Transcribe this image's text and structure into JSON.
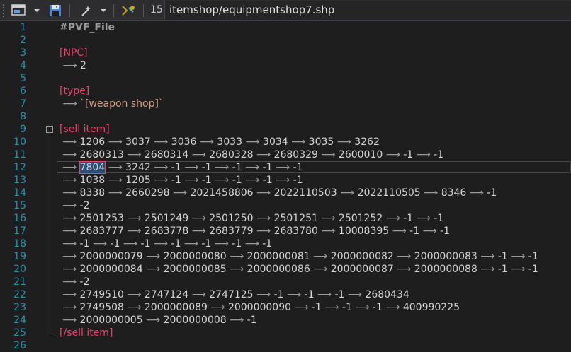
{
  "toolbar": {
    "line_number": "15",
    "file_path": "itemshop/equipmentshop7.shp"
  },
  "editor": {
    "lines": [
      {
        "n": "1",
        "segments": [
          {
            "t": "#PVF_File",
            "c": "title"
          }
        ]
      },
      {
        "n": "2",
        "segments": []
      },
      {
        "n": "3",
        "segments": [
          {
            "t": "[NPC]",
            "c": "tag"
          }
        ]
      },
      {
        "n": "4",
        "segments": [
          {
            "t": " ⟶ ",
            "c": "arrow"
          },
          {
            "t": "2",
            "c": "num"
          }
        ]
      },
      {
        "n": "5",
        "segments": []
      },
      {
        "n": "6",
        "segments": [
          {
            "t": "[type]",
            "c": "tag"
          }
        ]
      },
      {
        "n": "7",
        "segments": [
          {
            "t": " ⟶ ",
            "c": "arrow"
          },
          {
            "t": "`[weapon shop]`",
            "c": "str"
          }
        ]
      },
      {
        "n": "8",
        "segments": []
      },
      {
        "n": "9",
        "segments": [
          {
            "t": "[sell item]",
            "c": "tag"
          }
        ]
      },
      {
        "n": "10",
        "segments": [
          {
            "t": "⟶ ",
            "c": "arrow"
          },
          {
            "t": "1206",
            "c": "num"
          },
          {
            "t": " ⟶ ",
            "c": "arrow"
          },
          {
            "t": "3037",
            "c": "num"
          },
          {
            "t": " ⟶ ",
            "c": "arrow"
          },
          {
            "t": "3036",
            "c": "num"
          },
          {
            "t": " ⟶ ",
            "c": "arrow"
          },
          {
            "t": "3033",
            "c": "num"
          },
          {
            "t": " ⟶ ",
            "c": "arrow"
          },
          {
            "t": "3034",
            "c": "num"
          },
          {
            "t": " ⟶ ",
            "c": "arrow"
          },
          {
            "t": "3035",
            "c": "num"
          },
          {
            "t": " ⟶ ",
            "c": "arrow"
          },
          {
            "t": "3262",
            "c": "num"
          }
        ]
      },
      {
        "n": "11",
        "segments": [
          {
            "t": "⟶ ",
            "c": "arrow"
          },
          {
            "t": "2680313",
            "c": "num"
          },
          {
            "t": " ⟶ ",
            "c": "arrow"
          },
          {
            "t": "2680314",
            "c": "num"
          },
          {
            "t": " ⟶ ",
            "c": "arrow"
          },
          {
            "t": "2680328",
            "c": "num"
          },
          {
            "t": " ⟶ ",
            "c": "arrow"
          },
          {
            "t": "2680329",
            "c": "num"
          },
          {
            "t": " ⟶ ",
            "c": "arrow"
          },
          {
            "t": "2600010",
            "c": "num"
          },
          {
            "t": " ⟶ ",
            "c": "arrow"
          },
          {
            "t": "-1",
            "c": "num"
          },
          {
            "t": " ⟶ ",
            "c": "arrow"
          },
          {
            "t": "-1",
            "c": "num"
          }
        ]
      },
      {
        "n": "12",
        "highlight": true,
        "segments": [
          {
            "t": "⟶ ",
            "c": "arrow"
          },
          {
            "t": "7804",
            "c": "sel"
          },
          {
            "t": " ⟶ ",
            "c": "arrow"
          },
          {
            "t": "3242",
            "c": "num"
          },
          {
            "t": " ⟶ ",
            "c": "arrow"
          },
          {
            "t": "-1",
            "c": "num"
          },
          {
            "t": " ⟶ ",
            "c": "arrow"
          },
          {
            "t": "-1",
            "c": "num"
          },
          {
            "t": " ⟶ ",
            "c": "arrow"
          },
          {
            "t": "-1",
            "c": "num"
          },
          {
            "t": " ⟶ ",
            "c": "arrow"
          },
          {
            "t": "-1",
            "c": "num"
          },
          {
            "t": " ⟶ ",
            "c": "arrow"
          },
          {
            "t": "-1",
            "c": "num"
          }
        ]
      },
      {
        "n": "13",
        "segments": [
          {
            "t": "⟶ ",
            "c": "arrow"
          },
          {
            "t": "1038",
            "c": "num"
          },
          {
            "t": " ⟶ ",
            "c": "arrow"
          },
          {
            "t": "1205",
            "c": "num"
          },
          {
            "t": " ⟶ ",
            "c": "arrow"
          },
          {
            "t": "-1",
            "c": "num"
          },
          {
            "t": " ⟶ ",
            "c": "arrow"
          },
          {
            "t": "-1",
            "c": "num"
          },
          {
            "t": " ⟶ ",
            "c": "arrow"
          },
          {
            "t": "-1",
            "c": "num"
          },
          {
            "t": " ⟶ ",
            "c": "arrow"
          },
          {
            "t": "-1",
            "c": "num"
          },
          {
            "t": " ⟶ ",
            "c": "arrow"
          },
          {
            "t": "-1",
            "c": "num"
          }
        ]
      },
      {
        "n": "14",
        "segments": [
          {
            "t": "⟶ ",
            "c": "arrow"
          },
          {
            "t": "8338",
            "c": "num"
          },
          {
            "t": " ⟶ ",
            "c": "arrow"
          },
          {
            "t": "2660298",
            "c": "num"
          },
          {
            "t": " ⟶ ",
            "c": "arrow"
          },
          {
            "t": "2021458806",
            "c": "num"
          },
          {
            "t": " ⟶ ",
            "c": "arrow"
          },
          {
            "t": "2022110503",
            "c": "num"
          },
          {
            "t": " ⟶ ",
            "c": "arrow"
          },
          {
            "t": "2022110505",
            "c": "num"
          },
          {
            "t": " ⟶ ",
            "c": "arrow"
          },
          {
            "t": "8346",
            "c": "num"
          },
          {
            "t": " ⟶ ",
            "c": "arrow"
          },
          {
            "t": "-1",
            "c": "num"
          }
        ]
      },
      {
        "n": "15",
        "segments": [
          {
            "t": "⟶ ",
            "c": "arrow"
          },
          {
            "t": "-2",
            "c": "num"
          }
        ]
      },
      {
        "n": "16",
        "segments": [
          {
            "t": "⟶ ",
            "c": "arrow"
          },
          {
            "t": "2501253",
            "c": "num"
          },
          {
            "t": " ⟶ ",
            "c": "arrow"
          },
          {
            "t": "2501249",
            "c": "num"
          },
          {
            "t": " ⟶ ",
            "c": "arrow"
          },
          {
            "t": "2501250",
            "c": "num"
          },
          {
            "t": " ⟶ ",
            "c": "arrow"
          },
          {
            "t": "2501251",
            "c": "num"
          },
          {
            "t": " ⟶ ",
            "c": "arrow"
          },
          {
            "t": "2501252",
            "c": "num"
          },
          {
            "t": " ⟶ ",
            "c": "arrow"
          },
          {
            "t": "-1",
            "c": "num"
          },
          {
            "t": " ⟶ ",
            "c": "arrow"
          },
          {
            "t": "-1",
            "c": "num"
          }
        ]
      },
      {
        "n": "17",
        "segments": [
          {
            "t": "⟶ ",
            "c": "arrow"
          },
          {
            "t": "2683777",
            "c": "num"
          },
          {
            "t": " ⟶ ",
            "c": "arrow"
          },
          {
            "t": "2683778",
            "c": "num"
          },
          {
            "t": " ⟶ ",
            "c": "arrow"
          },
          {
            "t": "2683779",
            "c": "num"
          },
          {
            "t": " ⟶ ",
            "c": "arrow"
          },
          {
            "t": "2683780",
            "c": "num"
          },
          {
            "t": " ⟶ ",
            "c": "arrow"
          },
          {
            "t": "10008395",
            "c": "num"
          },
          {
            "t": " ⟶ ",
            "c": "arrow"
          },
          {
            "t": "-1",
            "c": "num"
          },
          {
            "t": " ⟶ ",
            "c": "arrow"
          },
          {
            "t": "-1",
            "c": "num"
          }
        ]
      },
      {
        "n": "18",
        "segments": [
          {
            "t": "⟶ ",
            "c": "arrow"
          },
          {
            "t": "-1",
            "c": "num"
          },
          {
            "t": " ⟶ ",
            "c": "arrow"
          },
          {
            "t": "-1",
            "c": "num"
          },
          {
            "t": " ⟶ ",
            "c": "arrow"
          },
          {
            "t": "-1",
            "c": "num"
          },
          {
            "t": " ⟶ ",
            "c": "arrow"
          },
          {
            "t": "-1",
            "c": "num"
          },
          {
            "t": " ⟶ ",
            "c": "arrow"
          },
          {
            "t": "-1",
            "c": "num"
          },
          {
            "t": " ⟶ ",
            "c": "arrow"
          },
          {
            "t": "-1",
            "c": "num"
          },
          {
            "t": " ⟶ ",
            "c": "arrow"
          },
          {
            "t": "-1",
            "c": "num"
          }
        ]
      },
      {
        "n": "19",
        "segments": [
          {
            "t": "⟶ ",
            "c": "arrow"
          },
          {
            "t": "2000000079",
            "c": "num"
          },
          {
            "t": " ⟶ ",
            "c": "arrow"
          },
          {
            "t": "2000000080",
            "c": "num"
          },
          {
            "t": " ⟶ ",
            "c": "arrow"
          },
          {
            "t": "2000000081",
            "c": "num"
          },
          {
            "t": " ⟶ ",
            "c": "arrow"
          },
          {
            "t": "2000000082",
            "c": "num"
          },
          {
            "t": " ⟶ ",
            "c": "arrow"
          },
          {
            "t": "2000000083",
            "c": "num"
          },
          {
            "t": " ⟶ ",
            "c": "arrow"
          },
          {
            "t": "-1",
            "c": "num"
          },
          {
            "t": " ⟶ ",
            "c": "arrow"
          },
          {
            "t": "-1",
            "c": "num"
          }
        ]
      },
      {
        "n": "20",
        "segments": [
          {
            "t": "⟶ ",
            "c": "arrow"
          },
          {
            "t": "2000000084",
            "c": "num"
          },
          {
            "t": " ⟶ ",
            "c": "arrow"
          },
          {
            "t": "2000000085",
            "c": "num"
          },
          {
            "t": " ⟶ ",
            "c": "arrow"
          },
          {
            "t": "2000000086",
            "c": "num"
          },
          {
            "t": " ⟶ ",
            "c": "arrow"
          },
          {
            "t": "2000000087",
            "c": "num"
          },
          {
            "t": " ⟶ ",
            "c": "arrow"
          },
          {
            "t": "2000000088",
            "c": "num"
          },
          {
            "t": " ⟶ ",
            "c": "arrow"
          },
          {
            "t": "-1",
            "c": "num"
          },
          {
            "t": " ⟶ ",
            "c": "arrow"
          },
          {
            "t": "-1",
            "c": "num"
          }
        ]
      },
      {
        "n": "21",
        "segments": [
          {
            "t": "⟶ ",
            "c": "arrow"
          },
          {
            "t": "-2",
            "c": "num"
          }
        ]
      },
      {
        "n": "22",
        "segments": [
          {
            "t": "⟶ ",
            "c": "arrow"
          },
          {
            "t": "2749510",
            "c": "num"
          },
          {
            "t": " ⟶ ",
            "c": "arrow"
          },
          {
            "t": "2747124",
            "c": "num"
          },
          {
            "t": " ⟶ ",
            "c": "arrow"
          },
          {
            "t": "2747125",
            "c": "num"
          },
          {
            "t": " ⟶ ",
            "c": "arrow"
          },
          {
            "t": "-1",
            "c": "num"
          },
          {
            "t": " ⟶ ",
            "c": "arrow"
          },
          {
            "t": "-1",
            "c": "num"
          },
          {
            "t": " ⟶ ",
            "c": "arrow"
          },
          {
            "t": "-1",
            "c": "num"
          },
          {
            "t": " ⟶ ",
            "c": "arrow"
          },
          {
            "t": "2680434",
            "c": "num"
          }
        ]
      },
      {
        "n": "23",
        "segments": [
          {
            "t": "⟶ ",
            "c": "arrow"
          },
          {
            "t": "2749508",
            "c": "num"
          },
          {
            "t": " ⟶ ",
            "c": "arrow"
          },
          {
            "t": "2000000089",
            "c": "num"
          },
          {
            "t": " ⟶ ",
            "c": "arrow"
          },
          {
            "t": "2000000090",
            "c": "num"
          },
          {
            "t": " ⟶ ",
            "c": "arrow"
          },
          {
            "t": "-1",
            "c": "num"
          },
          {
            "t": " ⟶ ",
            "c": "arrow"
          },
          {
            "t": "-1",
            "c": "num"
          },
          {
            "t": " ⟶ ",
            "c": "arrow"
          },
          {
            "t": "-1",
            "c": "num"
          },
          {
            "t": " ⟶ ",
            "c": "arrow"
          },
          {
            "t": "400990225",
            "c": "num"
          }
        ]
      },
      {
        "n": "24",
        "segments": [
          {
            "t": "⟶ ",
            "c": "arrow"
          },
          {
            "t": "2000000005",
            "c": "num"
          },
          {
            "t": " ⟶ ",
            "c": "arrow"
          },
          {
            "t": "2000000008",
            "c": "num"
          },
          {
            "t": " ⟶ ",
            "c": "arrow"
          },
          {
            "t": "-1",
            "c": "num"
          }
        ]
      },
      {
        "n": "25",
        "segments": [
          {
            "t": "[/sell item]",
            "c": "tag"
          }
        ]
      },
      {
        "n": "26",
        "segments": []
      }
    ]
  },
  "colors": {
    "background": "#1e1e1e",
    "line_number": "#2b91af",
    "tag": "#e8426d",
    "string": "#d69d85",
    "selection": "#264f78"
  }
}
